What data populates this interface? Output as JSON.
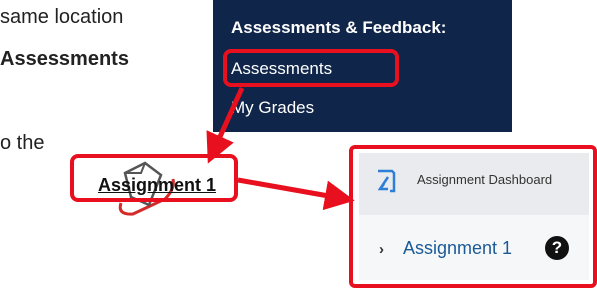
{
  "doc": {
    "line1": "same location",
    "line2": "Assessments",
    "line3": "o the"
  },
  "menu": {
    "heading": "Assessments & Feedback:",
    "items": [
      "Assessments",
      "My Grades"
    ]
  },
  "assignment_link": "Assignment 1",
  "dashboard": {
    "title": "Assignment Dashboard",
    "item": "Assignment 1",
    "help": "?"
  },
  "colors": {
    "menu_bg": "#0f2549",
    "highlight": "#e8101e",
    "link": "#1a5a96"
  }
}
